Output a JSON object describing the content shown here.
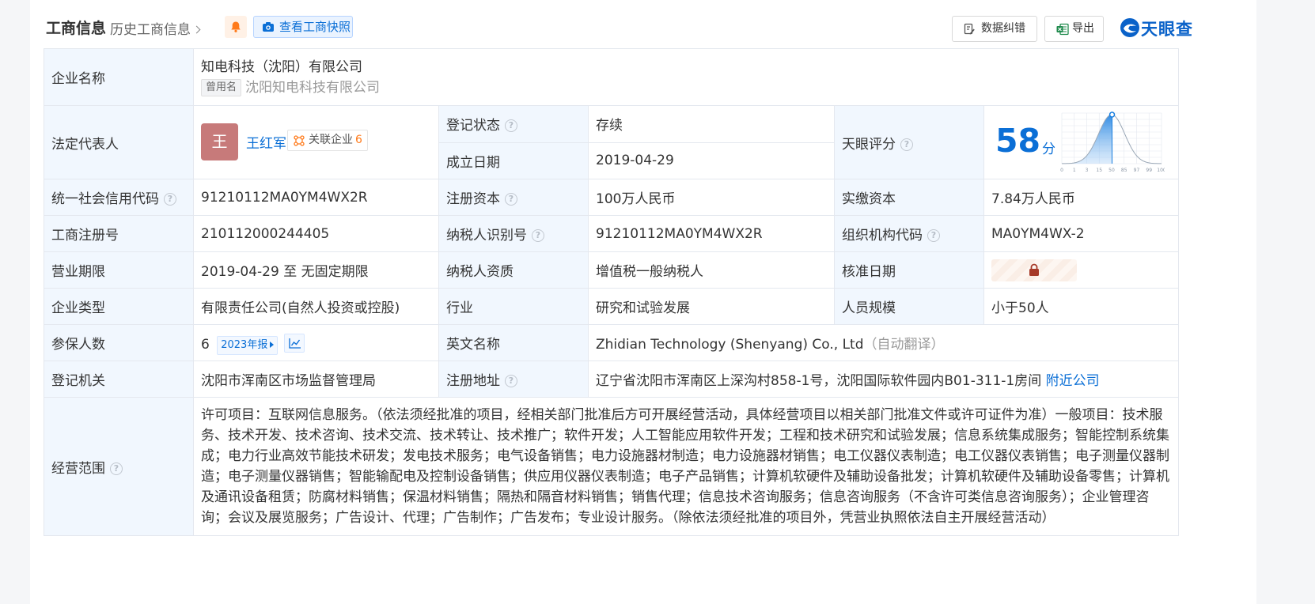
{
  "header": {
    "title": "工商信息",
    "history_link": "历史工商信息",
    "snapshot_label": "查看工商快照",
    "correct_label": "数据纠错",
    "export_label": "导出",
    "logo_text": "天眼查"
  },
  "rows": {
    "company_name": {
      "label": "企业名称",
      "value": "知电科技（沈阳）有限公司",
      "used_tag": "曾用名",
      "used_name": "沈阳知电科技有限公司"
    },
    "legal_rep": {
      "label": "法定代表人",
      "avatar": "王",
      "name": "王红军",
      "related_label": "关联企业",
      "related_count": "6"
    },
    "reg_status": {
      "label": "登记状态",
      "value": "存续"
    },
    "found_date": {
      "label": "成立日期",
      "value": "2019-04-29"
    },
    "tianyan_score": {
      "label": "天眼评分",
      "value": "58",
      "unit": "分"
    },
    "credit_code": {
      "label": "统一社会信用代码",
      "value": "91210112MA0YM4WX2R"
    },
    "reg_capital": {
      "label": "注册资本",
      "value": "100万人民币"
    },
    "paid_capital": {
      "label": "实缴资本",
      "value": "7.84万人民币"
    },
    "biz_reg_no": {
      "label": "工商注册号",
      "value": "210112000244405"
    },
    "taxpayer_id": {
      "label": "纳税人识别号",
      "value": "91210112MA0YM4WX2R"
    },
    "org_code": {
      "label": "组织机构代码",
      "value": "MA0YM4WX-2"
    },
    "biz_term": {
      "label": "营业期限",
      "value": "2019-04-29 至 无固定期限"
    },
    "taxpayer_qual": {
      "label": "纳税人资质",
      "value": "增值税一般纳税人"
    },
    "approval_date": {
      "label": "核准日期"
    },
    "company_type": {
      "label": "企业类型",
      "value": "有限责任公司(自然人投资或控股)"
    },
    "industry": {
      "label": "行业",
      "value": "研究和试验发展"
    },
    "staff_size": {
      "label": "人员规模",
      "value": "小于50人"
    },
    "insured": {
      "label": "参保人数",
      "value": "6",
      "report_label": "2023年报"
    },
    "english_name": {
      "label": "英文名称",
      "value": "Zhidian Technology (Shenyang) Co., Ltd",
      "auto_tag": "（自动翻译）"
    },
    "reg_authority": {
      "label": "登记机关",
      "value": "沈阳市浑南区市场监督管理局"
    },
    "reg_address": {
      "label": "注册地址",
      "value": "辽宁省沈阳市浑南区上深沟村858-1号，沈阳国际软件园内B01-311-1房间",
      "nearby_label": "附近公司"
    },
    "biz_scope": {
      "label": "经营范围",
      "value": "许可项目：互联网信息服务。（依法须经批准的项目，经相关部门批准后方可开展经营活动，具体经营项目以相关部门批准文件或许可证件为准）一般项目：技术服务、技术开发、技术咨询、技术交流、技术转让、技术推广；软件开发；人工智能应用软件开发；工程和技术研究和试验发展；信息系统集成服务；智能控制系统集成；电力行业高效节能技术研发；发电技术服务；电气设备销售；电力设施器材制造；电力设施器材销售；电工仪器仪表制造；电工仪器仪表销售；电子测量仪器制造；电子测量仪器销售；智能输配电及控制设备销售；供应用仪器仪表制造；电子产品销售；计算机软硬件及辅助设备批发；计算机软硬件及辅助设备零售；计算机及通讯设备租赁；防腐材料销售；保温材料销售；隔热和隔音材料销售；销售代理；信息技术咨询服务；信息咨询服务（不含许可类信息咨询服务）；企业管理咨询；会议及展览服务；广告设计、代理；广告制作；广告发布；专业设计服务。（除依法须经批准的项目外，凭营业执照依法自主开展经营活动）"
    }
  },
  "score_chart": {
    "x_ticks": [
      "0",
      "1",
      "3",
      "15",
      "50",
      "85",
      "97",
      "99",
      "100"
    ],
    "marker_value": 58,
    "curve_color": "#1a7fe0"
  },
  "colors": {
    "label_bg": "#f1f7fe",
    "link": "#0b6fd6",
    "status_green": "#19a34a",
    "border": "#e4e8ef"
  }
}
